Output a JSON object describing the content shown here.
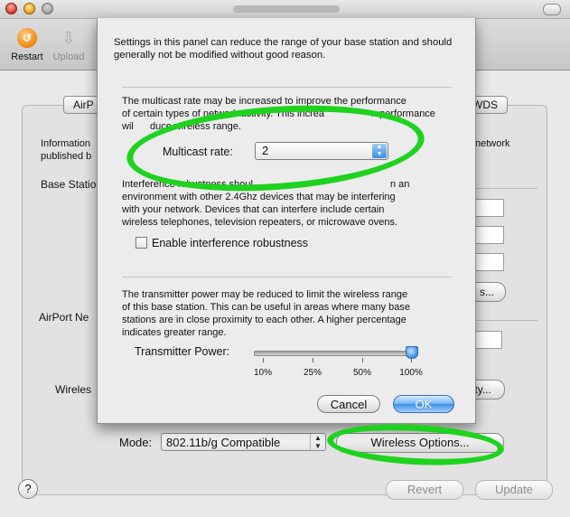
{
  "toolbar": {
    "restart_label": "Restart",
    "upload_label": "Upload"
  },
  "background": {
    "tab_airport": "AirP",
    "tab_wds": "WDS",
    "info_line1": "Information",
    "info_line2": "published b",
    "info_right": "network",
    "section_base_station": "Base Statio",
    "section_airport_network": "AirPort Ne",
    "wireless_label": "Wireles",
    "security_btn": "urity...",
    "options_btn": "s...",
    "mode_label": "Mode:",
    "mode_value": "802.11b/g Compatible",
    "wireless_options_btn": "Wireless Options...",
    "help": "?",
    "revert": "Revert",
    "update": "Update"
  },
  "sheet": {
    "intro": "Settings in this panel can reduce the range of your base station and should generally not be modified without good reason.",
    "multicast_desc_1": "The multicast rate may be increased to improve the performance",
    "multicast_desc_2": "of certain types of network activity. This increa",
    "multicast_desc_2b": "n performance",
    "multicast_desc_3": "wil",
    "multicast_desc_3b": "duce wireless range.",
    "multicast_label": "Multicast rate:",
    "multicast_value": "2",
    "interference_desc_1": "Interference robustness shoul",
    "interference_desc_1b": "n an",
    "interference_desc_2": "environment with other 2.4Ghz devices that may be interfering",
    "interference_desc_3": "with your network. Devices that can interfere include certain",
    "interference_desc_4": "wireless telephones, television repeaters, or microwave ovens.",
    "interference_checkbox_label": "Enable interference robustness",
    "power_desc_1": "The transmitter power may be reduced to limit the wireless range",
    "power_desc_2": "of this base station. This can be useful in areas where many base",
    "power_desc_3": "stations are in close proximity to each other. A higher percentage",
    "power_desc_4": "indicates greater range.",
    "power_label": "Transmitter Power:",
    "power_ticks": [
      "10%",
      "25%",
      "50%",
      "100%"
    ],
    "power_value_percent": 100,
    "cancel_label": "Cancel",
    "ok_label": "OK"
  },
  "colors": {
    "annotation": "#1fd21f",
    "accent": "#3e8fe2"
  }
}
